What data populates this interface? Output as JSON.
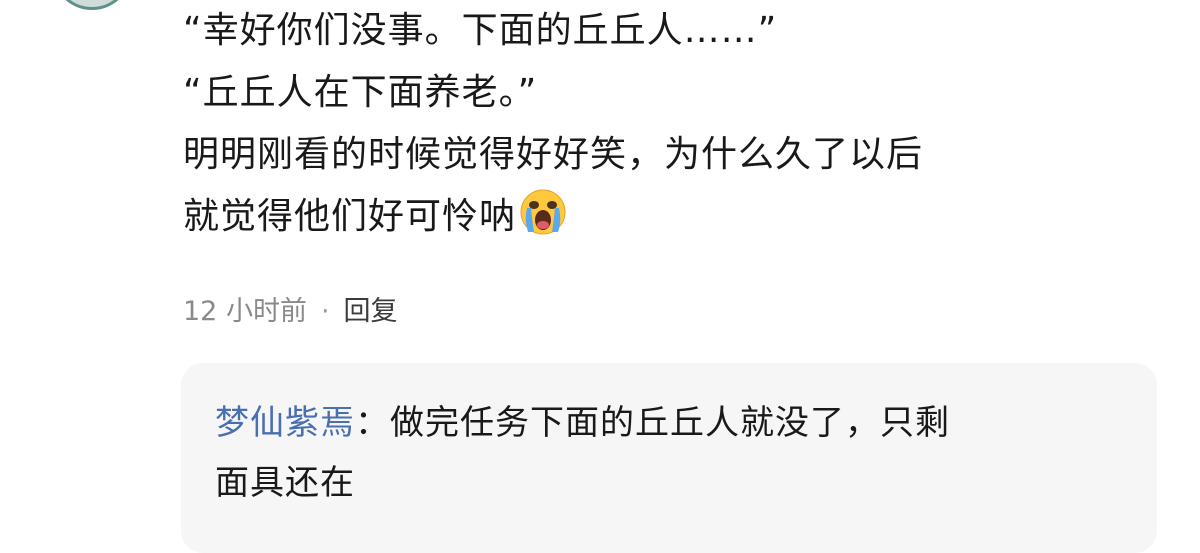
{
  "comment": {
    "lines": [
      "“幸好你们没事。下面的丘丘人……”",
      "“丘丘人在下面养老。”",
      "明明刚看的时候觉得好好笑，为什么久了以后",
      "就觉得他们好可怜呐"
    ],
    "emoji": "loudly-crying-face",
    "time": "12 小时前",
    "separator": "·",
    "reply_label": "回复"
  },
  "reply": {
    "username": "梦仙紫焉",
    "colon": "：",
    "text_line1": "做完任务下面的丘丘人就没了，只剩",
    "text_line2": "面具还在"
  },
  "colors": {
    "text": "#191919",
    "meta": "#8a8a8a",
    "username": "#4a6fb0",
    "reply_bg": "#f6f6f6"
  }
}
